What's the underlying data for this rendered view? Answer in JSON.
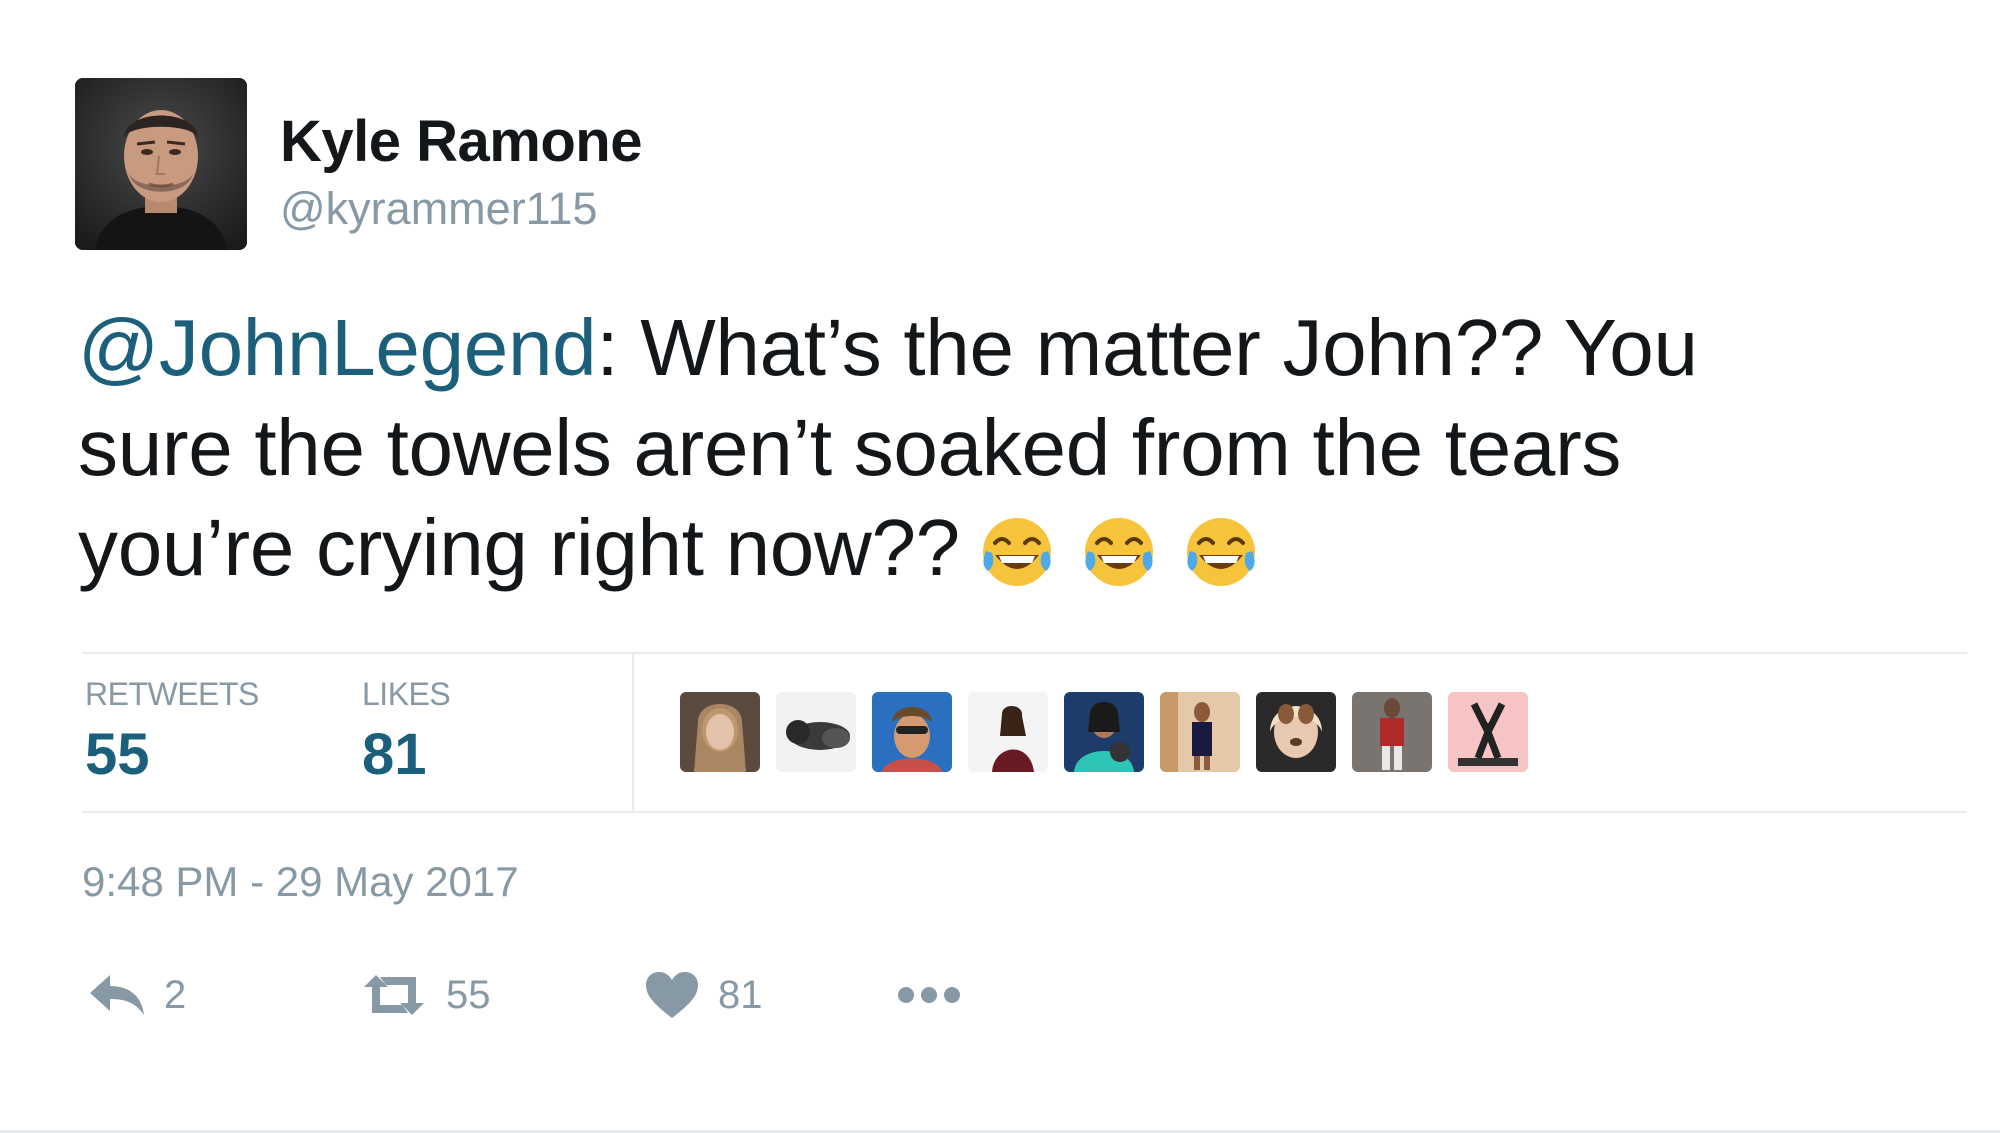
{
  "author": {
    "display_name": "Kyle Ramone",
    "handle": "@kyrammer115",
    "avatar_icon": "profile-photo"
  },
  "tweet": {
    "mention": "@JohnLegend",
    "line1_rest": ": What’s the matter John?? You",
    "line2": "sure the towels aren’t soaked from the tears",
    "line3": "you’re crying right now??",
    "emojis": [
      "face-with-tears-of-joy",
      "face-with-tears-of-joy",
      "face-with-tears-of-joy"
    ]
  },
  "stats": {
    "retweets_label": "RETWEETS",
    "retweets_value": "55",
    "likes_label": "LIKES",
    "likes_value": "81",
    "liker_count_shown": 9
  },
  "timestamp": "9:48 PM - 29 May 2017",
  "actions": {
    "reply_count": "2",
    "retweet_count": "55",
    "like_count": "81"
  },
  "colors": {
    "mention": "#1b5f7a",
    "stat_value": "#1b5f7a",
    "muted": "#8899a6",
    "text": "#14171a",
    "divider": "#e6ecf0",
    "emoji_yellow": "#f7c33b"
  }
}
